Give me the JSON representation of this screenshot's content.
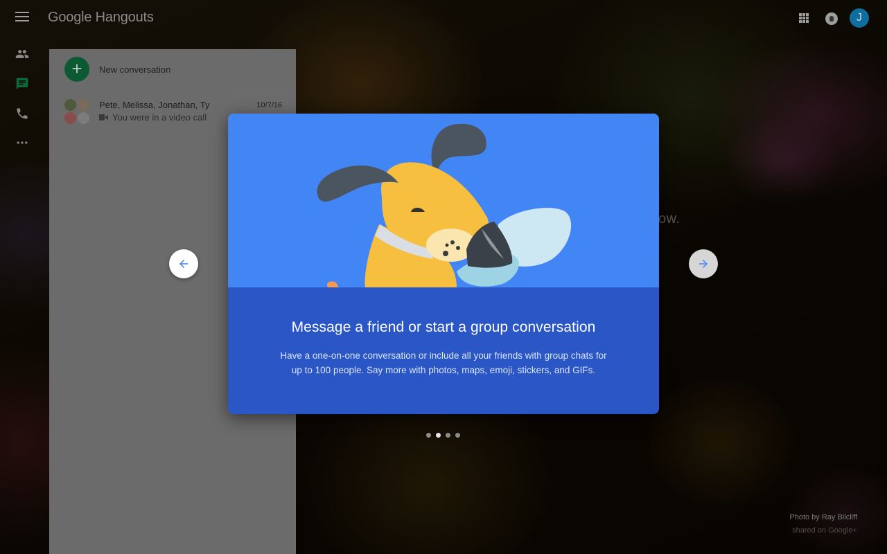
{
  "header": {
    "app_title": "Google Hangouts",
    "avatar_initial": "J",
    "icons": [
      "menu-icon",
      "apps-grid-icon",
      "notifications-icon"
    ]
  },
  "rail": {
    "items": [
      {
        "name": "people-icon"
      },
      {
        "name": "chat-icon",
        "active": true
      },
      {
        "name": "phone-icon"
      },
      {
        "name": "more-icon"
      }
    ]
  },
  "panel": {
    "new_conversation_label": "New conversation",
    "conversations": [
      {
        "title": "Pete, Melissa, Jonathan, Ty",
        "date": "10/7/16",
        "subtitle": "You were in a video call"
      }
    ]
  },
  "background": {
    "partial_text": "ow.",
    "credit_photo": "Photo by Ray Bilcliff",
    "credit_shared": "shared on Google+"
  },
  "modal": {
    "title": "Message a friend or start a group conversation",
    "description": "Have a one-on-one conversation or include all your friends with group chats for up to 100 people. Say more with photos, maps, emoji, stickers, and GIFs.",
    "page_count": 4,
    "current_page": 2
  },
  "colors": {
    "illustration_bg": "#4285f4",
    "modal_body_bg": "#2a56c6",
    "new_conversation_button": "#0b5a34",
    "chat_active": "#0f9d58"
  }
}
